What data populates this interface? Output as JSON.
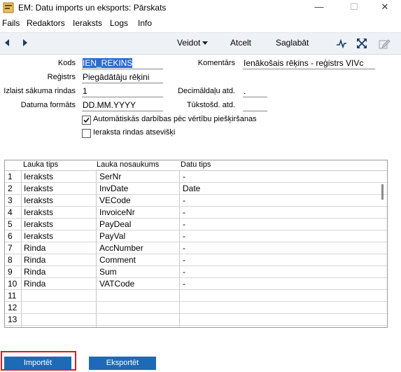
{
  "window": {
    "title": "EM: Datu imports un eksports: Pārskats",
    "minimize": "—",
    "maximize": "☐",
    "close": "✕"
  },
  "menu": [
    "Fails",
    "Redaktors",
    "Ieraksts",
    "Logs",
    "Info"
  ],
  "toolbar": {
    "create_label": "Veidot",
    "cancel_label": "Atcelt",
    "save_label": "Saglabāt"
  },
  "form": {
    "kods_label": "Kods",
    "kods_value": "IEN_REKINS",
    "komentars_label": "Komentārs",
    "komentars_value": "Ienākošais rēķins - reģistrs VIVc",
    "registrs_label": "Reģistrs",
    "registrs_value": "Piegādātāju rēķini",
    "start_row_label": "Izlaist sākuma rindas",
    "start_row_value": "1",
    "decimal_label": "Decimāldaļu atd.",
    "decimal_value": ".",
    "date_format_label": "Datuma formāts",
    "date_format_value": "DD.MM.YYYY",
    "thousands_label": "Tūkstošd. atd.",
    "thousands_value": "",
    "auto_actions_label": "Automātiskās darbības pēc vērtību piešķiršanas",
    "auto_actions_checked": true,
    "separate_rows_label": "Ieraksta rindas atsevišķi",
    "separate_rows_checked": false
  },
  "grid": {
    "columns": [
      "Lauka tips",
      "Lauka nosaukums",
      "Datu tips"
    ],
    "rows": [
      {
        "n": "1",
        "type": "Ieraksts",
        "name": "SerNr",
        "dtype": "-"
      },
      {
        "n": "2",
        "type": "Ieraksts",
        "name": "InvDate",
        "dtype": "Date"
      },
      {
        "n": "3",
        "type": "Ieraksts",
        "name": "VECode",
        "dtype": "-"
      },
      {
        "n": "4",
        "type": "Ieraksts",
        "name": "InvoiceNr",
        "dtype": "-"
      },
      {
        "n": "5",
        "type": "Ieraksts",
        "name": "PayDeal",
        "dtype": "-"
      },
      {
        "n": "6",
        "type": "Ieraksts",
        "name": "PayVal",
        "dtype": "-"
      },
      {
        "n": "7",
        "type": "Rinda",
        "name": "AccNumber",
        "dtype": "-"
      },
      {
        "n": "8",
        "type": "Rinda",
        "name": "Comment",
        "dtype": "-"
      },
      {
        "n": "9",
        "type": "Rinda",
        "name": "Sum",
        "dtype": "-"
      },
      {
        "n": "10",
        "type": "Rinda",
        "name": "VATCode",
        "dtype": "-"
      },
      {
        "n": "11",
        "type": "",
        "name": "",
        "dtype": ""
      },
      {
        "n": "12",
        "type": "",
        "name": "",
        "dtype": ""
      },
      {
        "n": "13",
        "type": "",
        "name": "",
        "dtype": ""
      }
    ]
  },
  "buttons": {
    "import_label": "Importēt",
    "export_label": "Eksportēt"
  },
  "colors": {
    "accent": "#1e6ab5",
    "highlight": "#d0202a",
    "selection": "#2a6bd6",
    "toolbar_bg": "#eef1f5"
  },
  "icons": [
    "app-icon",
    "back-arrow-icon",
    "forward-arrow-icon",
    "dropdown-arrow-icon",
    "activity-icon",
    "expand-icon",
    "edit-icon"
  ]
}
